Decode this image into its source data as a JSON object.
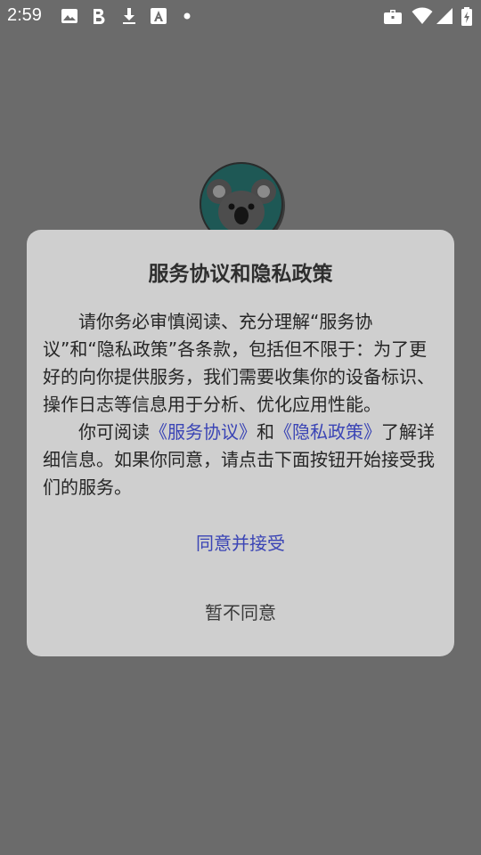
{
  "status_bar": {
    "time": "2:59",
    "left_icons": [
      "image-icon",
      "bold-b-icon",
      "download-icon",
      "text-a-icon",
      "dot-icon"
    ],
    "right_icons": [
      "briefcase-icon",
      "wifi-icon",
      "signal-icon",
      "battery-charging-icon"
    ]
  },
  "app": {
    "avatar_icon": "koala-icon"
  },
  "dialog": {
    "title": "服务协议和隐私政策",
    "paragraph1": "请你务必审慎阅读、充分理解“服务协议”和“隐私政策”各条款，包括但不限于：为了更好的向你提供服务，我们需要收集你的设备标识、操作日志等信息用于分析、优化应用性能。",
    "p2_text1": "你可阅读",
    "p2_link1": "《服务协议》",
    "p2_text2": "和",
    "p2_link2": "《隐私政策》",
    "p2_text3": "了解详细信息。如果你同意，请点击下面按钮开始接受我们的服务。",
    "agree_label": "同意并接受",
    "decline_label": "暂不同意"
  },
  "colors": {
    "overlay": "#6b6b6b",
    "dialog_bg": "#cfcfcf",
    "link": "#3a44b5"
  }
}
